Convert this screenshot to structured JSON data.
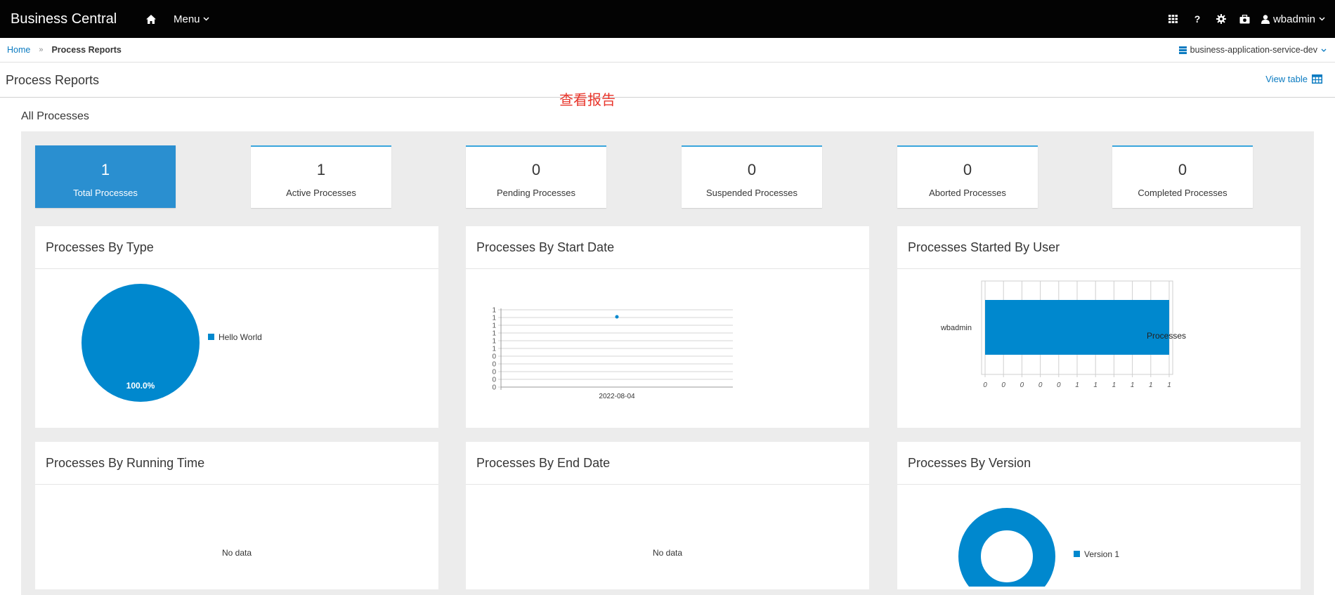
{
  "topbar": {
    "brand": "Business Central",
    "menu_label": "Menu",
    "user_label": "wbadmin",
    "icons": [
      "home-icon",
      "chevron-down-icon",
      "apps-grid-icon",
      "help-icon",
      "gear-icon",
      "case-icon",
      "user-icon"
    ]
  },
  "breadcrumb": {
    "home": "Home",
    "separator": "»",
    "current": "Process Reports",
    "space": "business-application-service-dev"
  },
  "page": {
    "title": "Process Reports",
    "annotation": "查看报告",
    "view_table": "View table",
    "section_title": "All Processes"
  },
  "tiles": [
    {
      "count": "1",
      "label": "Total Processes",
      "selected": true
    },
    {
      "count": "1",
      "label": "Active Processes",
      "selected": false
    },
    {
      "count": "0",
      "label": "Pending Processes",
      "selected": false
    },
    {
      "count": "0",
      "label": "Suspended Processes",
      "selected": false
    },
    {
      "count": "0",
      "label": "Aborted Processes",
      "selected": false
    },
    {
      "count": "0",
      "label": "Completed Processes",
      "selected": false
    }
  ],
  "cards": {
    "by_type": {
      "title": "Processes By Type"
    },
    "by_start_date": {
      "title": "Processes By Start Date"
    },
    "by_user": {
      "title": "Processes Started By User"
    },
    "by_running_time": {
      "title": "Processes By Running Time",
      "no_data": "No data"
    },
    "by_end_date": {
      "title": "Processes By End Date",
      "no_data": "No data"
    },
    "by_version": {
      "title": "Processes By Version"
    }
  },
  "colors": {
    "accent": "#0b7bc1",
    "chart_blue": "#0088ce",
    "tile_selected": "#2a8fd0",
    "annotation_red": "#e8352b"
  },
  "chart_data": [
    {
      "type": "pie",
      "title": "Processes By Type",
      "categories": [
        "Hello World"
      ],
      "values": [
        100.0
      ],
      "data_labels": [
        "100.0%"
      ],
      "legend": "right"
    },
    {
      "type": "line",
      "title": "Processes By Start Date",
      "x": [
        "2022-08-04"
      ],
      "values": [
        1
      ],
      "y_tick_labels": [
        "0",
        "0",
        "0",
        "0",
        "0",
        "1",
        "1",
        "1",
        "1",
        "1",
        "1"
      ],
      "ylim": [
        0,
        1
      ],
      "grid": true
    },
    {
      "type": "bar",
      "orientation": "horizontal",
      "title": "Processes Started By User",
      "categories": [
        "wbadmin"
      ],
      "series": [
        {
          "name": "Processes",
          "values": [
            1
          ]
        }
      ],
      "x_tick_labels": [
        "0",
        "0",
        "0",
        "0",
        "0",
        "1",
        "1",
        "1",
        "1",
        "1",
        "1"
      ],
      "xlim": [
        0,
        1
      ],
      "grid": true
    },
    {
      "type": "pie",
      "subtype": "donut",
      "title": "Processes By Version",
      "categories": [
        "Version 1"
      ],
      "values": [
        100
      ],
      "legend": "right"
    }
  ]
}
